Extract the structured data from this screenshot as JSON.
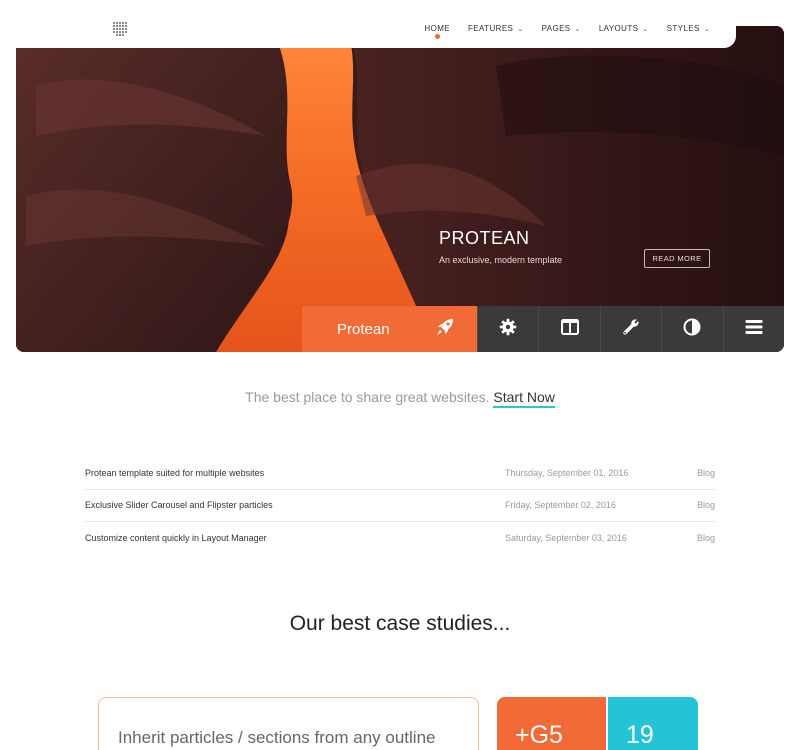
{
  "nav": {
    "items": [
      {
        "label": "HOME",
        "active": true,
        "dropdown": false
      },
      {
        "label": "FEATURES",
        "active": false,
        "dropdown": true
      },
      {
        "label": "PAGES",
        "active": false,
        "dropdown": true
      },
      {
        "label": "LAYOUTS",
        "active": false,
        "dropdown": true
      },
      {
        "label": "STYLES",
        "active": false,
        "dropdown": true
      }
    ],
    "chevron": "⌄"
  },
  "hero": {
    "title": "PROTEAN",
    "subtitle": "An exclusive, modern template",
    "read_more_label": "READ MORE"
  },
  "toolbar": {
    "brand_label": "Protean",
    "brand_icon": "rocket-icon",
    "buttons": [
      "gear-icon",
      "columns-icon",
      "wrench-icon",
      "contrast-icon",
      "menu-icon"
    ]
  },
  "tagline": {
    "text": "The best place to share great websites.",
    "cta_label": "Start Now"
  },
  "blog": {
    "rows": [
      {
        "title": "Protean template suited for multiple websites",
        "date": "Thursday, September 01, 2016",
        "category": "Blog"
      },
      {
        "title": "Exclusive Slider Carousel and Flipster particles",
        "date": "Friday, September 02, 2016",
        "category": "Blog"
      },
      {
        "title": "Customize content quickly in Layout Manager",
        "date": "Saturday, September 03, 2016",
        "category": "Blog"
      }
    ]
  },
  "case_studies": {
    "title": "Our best case studies...",
    "feature_text": "Inherit particles / sections from any outline",
    "tiles": [
      {
        "label": "+G5",
        "color": "#f26a36"
      },
      {
        "label": "19",
        "color": "#24c3d6"
      }
    ]
  },
  "colors": {
    "accent": "#f26a36",
    "teal": "#24c3d6",
    "toolbar_bg": "#3a3a3a"
  }
}
